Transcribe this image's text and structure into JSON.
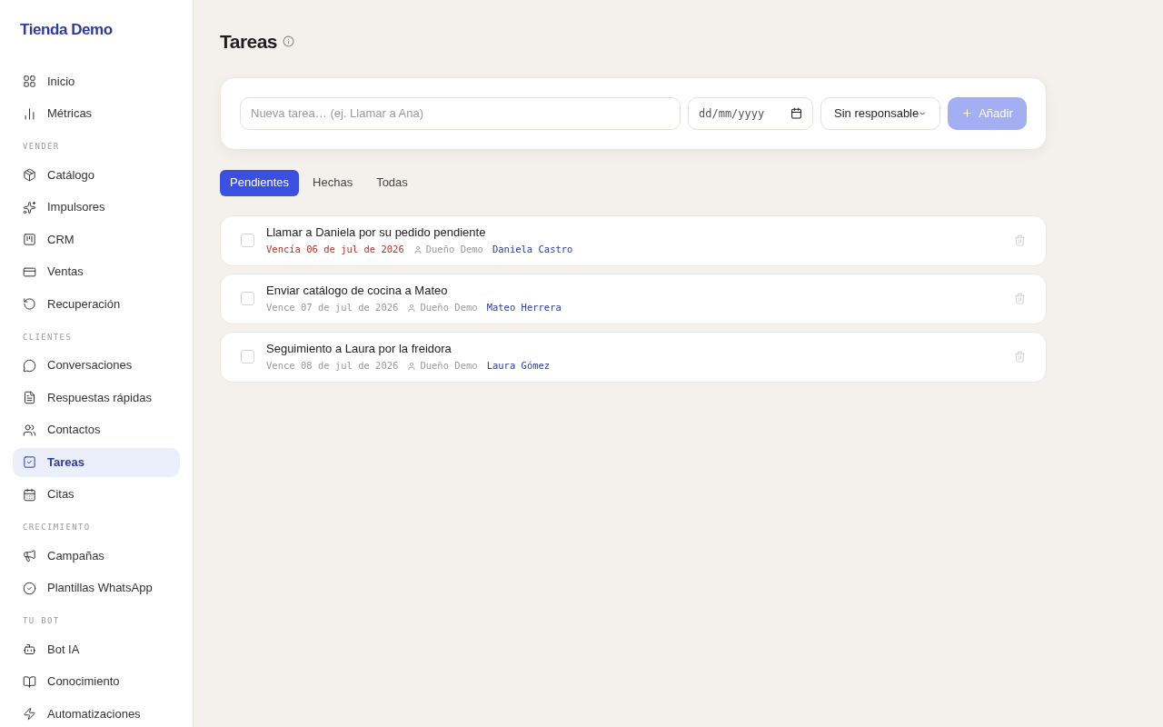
{
  "brand": "Tienda Demo",
  "sidebar": {
    "sections": [
      {
        "items": [
          {
            "label": "Inicio",
            "selected": false
          },
          {
            "label": "Métricas",
            "selected": false
          }
        ]
      },
      {
        "heading": "VENDER",
        "items": [
          {
            "label": "Catálogo",
            "selected": false
          },
          {
            "label": "Impulsores",
            "selected": false
          },
          {
            "label": "CRM",
            "selected": false
          },
          {
            "label": "Ventas",
            "selected": false
          },
          {
            "label": "Recuperación",
            "selected": false
          }
        ]
      },
      {
        "heading": "CLIENTES",
        "items": [
          {
            "label": "Conversaciones",
            "selected": false
          },
          {
            "label": "Respuestas rápidas",
            "selected": false
          },
          {
            "label": "Contactos",
            "selected": false
          },
          {
            "label": "Tareas",
            "selected": true
          },
          {
            "label": "Citas",
            "selected": false
          }
        ]
      },
      {
        "heading": "CRECIMIENTO",
        "items": [
          {
            "label": "Campañas",
            "selected": false
          },
          {
            "label": "Plantillas WhatsApp",
            "selected": false
          }
        ]
      },
      {
        "heading": "TU BOT",
        "items": [
          {
            "label": "Bot IA",
            "selected": false
          },
          {
            "label": "Conocimiento",
            "selected": false
          },
          {
            "label": "Automatizaciones",
            "selected": false
          }
        ]
      }
    ]
  },
  "page_title": "Tareas",
  "form": {
    "task_placeholder": "Nueva tarea… (ej. Llamar a Ana)",
    "date_placeholder": "dd/mm/yyyy",
    "assignee": "Sin responsable",
    "add_button": "Añadir",
    "add_disabled": true
  },
  "tabs": [
    {
      "label": "Pendientes",
      "selected": true
    },
    {
      "label": "Hechas",
      "selected": false
    },
    {
      "label": "Todas",
      "selected": false
    }
  ],
  "tasks": [
    {
      "title": "Llamar a Daniela por su pedido pendiente",
      "due": "Vencía 06 de jul de 2026",
      "overdue": true,
      "owner": "Dueño Demo",
      "contact": "Daniela Castro",
      "checked": false
    },
    {
      "title": "Enviar catálogo de cocina a Mateo",
      "due": "Vence 07 de jul de 2026",
      "overdue": false,
      "owner": "Dueño Demo",
      "contact": "Mateo Herrera",
      "checked": false
    },
    {
      "title": "Seguimiento a Laura por la freidora",
      "due": "Vence 08 de jul de 2026",
      "overdue": false,
      "owner": "Dueño Demo",
      "contact": "Laura Gómez",
      "checked": false
    }
  ]
}
